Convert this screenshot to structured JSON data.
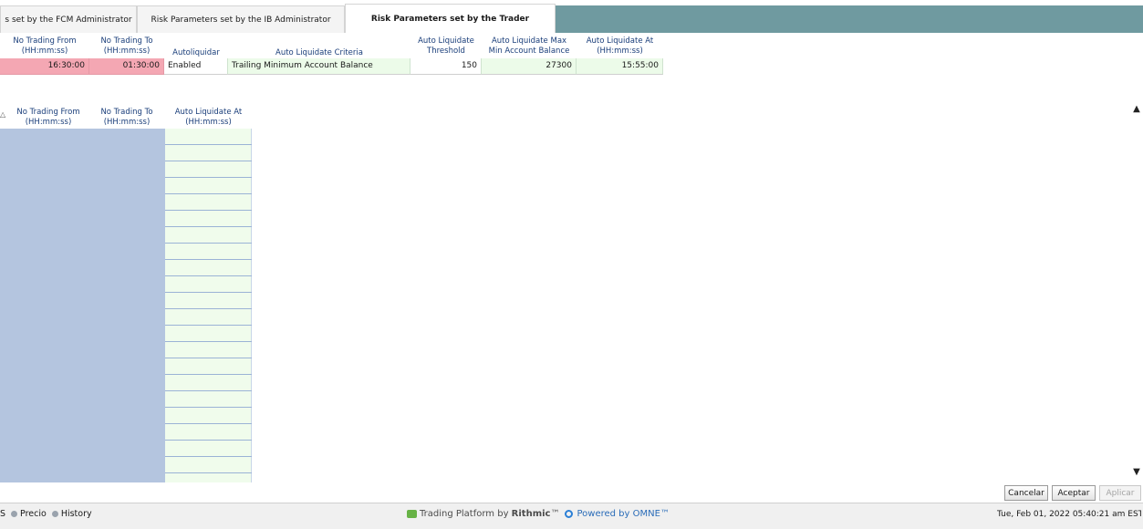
{
  "tabs": [
    {
      "label": "s set by the FCM Administrator",
      "active": false
    },
    {
      "label": "Risk Parameters set by the IB Administrator",
      "active": false
    },
    {
      "label": "Risk Parameters set by the Trader",
      "active": true
    }
  ],
  "top_table": {
    "headers": {
      "no_trading_from": "No Trading From\n(HH:mm:ss)",
      "no_trading_to": "No Trading To\n(HH:mm:ss)",
      "autoliquidar": "Autoliquidar",
      "criteria": "Auto Liquidate Criteria",
      "threshold": "Auto Liquidate\nThreshold",
      "max_min_balance": "Auto Liquidate Max\nMin Account Balance",
      "liquidate_at": "Auto Liquidate At\n(HH:mm:ss)"
    },
    "row": {
      "no_trading_from": "16:30:00",
      "no_trading_to": "01:30:00",
      "autoliquidar": "Enabled",
      "criteria": "Trailing Minimum Account Balance",
      "threshold": "150",
      "max_min_balance": "27300",
      "liquidate_at": "15:55:00"
    }
  },
  "bottom_table": {
    "headers": {
      "no_trading_from": "No Trading From\n(HH:mm:ss)",
      "no_trading_to": "No Trading To\n(HH:mm:ss)",
      "liquidate_at": "Auto Liquidate At\n(HH:mm:ss)"
    }
  },
  "buttons": {
    "cancel": "Cancelar",
    "accept": "Aceptar",
    "apply": "Aplicar"
  },
  "status": {
    "left_cut": "S",
    "item_precio": "Precio",
    "item_history": "History",
    "platform_prefix": "Trading Platform by ",
    "platform_brand": "Rithmic",
    "platform_tm": "™",
    "powered": "Powered by OMNE™",
    "datetime": "Tue, Feb 01, 2022 05:40:21 am EST"
  },
  "colors": {
    "tab_fill": "#6f9aa0",
    "pink_cell": "#f4a7b3",
    "green_cell": "#ecfbe9",
    "blue_column": "#b4c5df"
  }
}
